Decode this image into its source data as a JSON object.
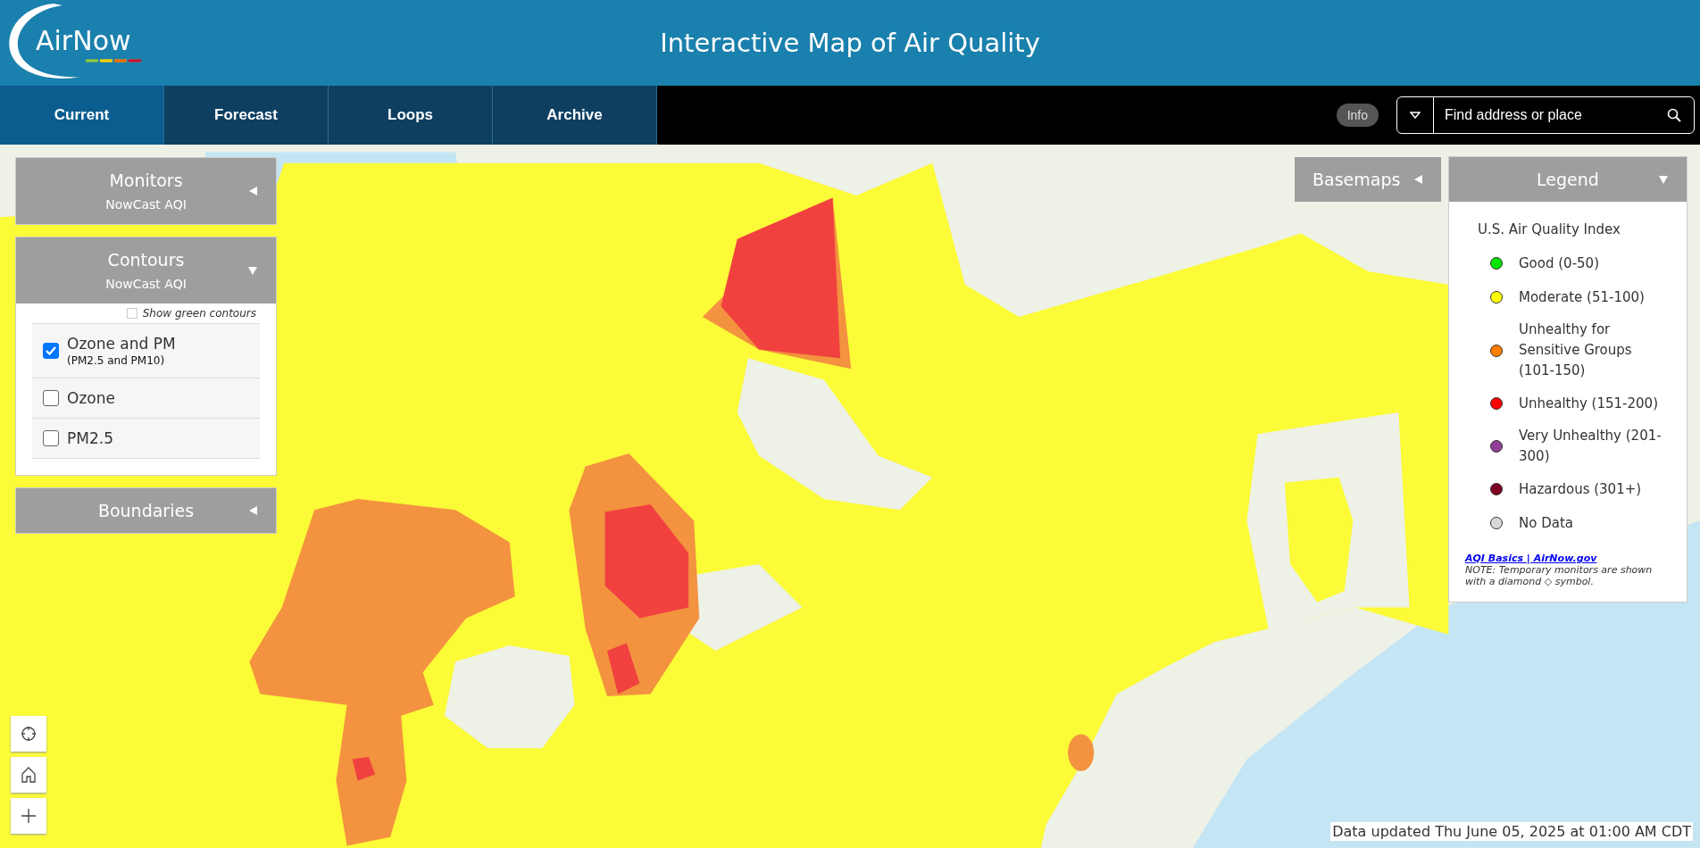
{
  "header": {
    "logo": "AirNow",
    "title": "Interactive Map of Air Quality"
  },
  "tabs": [
    {
      "label": "Current",
      "selected": true
    },
    {
      "label": "Forecast",
      "selected": false
    },
    {
      "label": "Loops",
      "selected": false
    },
    {
      "label": "Archive",
      "selected": false
    }
  ],
  "info_button": "Info",
  "search": {
    "placeholder": "Find address or place"
  },
  "left_panels": [
    {
      "title": "Monitors",
      "subtitle": "NowCast AQI",
      "expanded": false
    },
    {
      "title": "Contours",
      "subtitle": "NowCast AQI",
      "expanded": true,
      "green_contours": {
        "label": "Show green contours",
        "checked": false
      },
      "layers": [
        {
          "label": "Ozone and PM",
          "sublabel": "(PM2.5 and PM10)",
          "checked": true
        },
        {
          "label": "Ozone",
          "checked": false
        },
        {
          "label": "PM2.5",
          "checked": false
        }
      ]
    },
    {
      "title": "Boundaries",
      "expanded": false
    }
  ],
  "basemaps": {
    "title": "Basemaps",
    "expanded": false
  },
  "legend": {
    "title": "Legend",
    "expanded": true,
    "heading": "U.S. Air Quality Index",
    "items": [
      {
        "label": "Good (0-50)",
        "color": "#00e400"
      },
      {
        "label": "Moderate (51-100)",
        "color": "#ffff00"
      },
      {
        "label": "Unhealthy for Sensitive Groups (101-150)",
        "color": "#ff7e00"
      },
      {
        "label": "Unhealthy (151-200)",
        "color": "#ff0000"
      },
      {
        "label": "Very Unhealthy (201-300)",
        "color": "#8f3f97"
      },
      {
        "label": "Hazardous (301+)",
        "color": "#7e0023"
      },
      {
        "label": "No Data",
        "color": "#d9d9d9"
      }
    ],
    "link": "AQI Basics | AirNow.gov",
    "note": "NOTE: Temporary monitors are shown with a diamond ◇ symbol."
  },
  "status": "Data updated Thu June 05, 2025 at 01:00 AM CDT"
}
